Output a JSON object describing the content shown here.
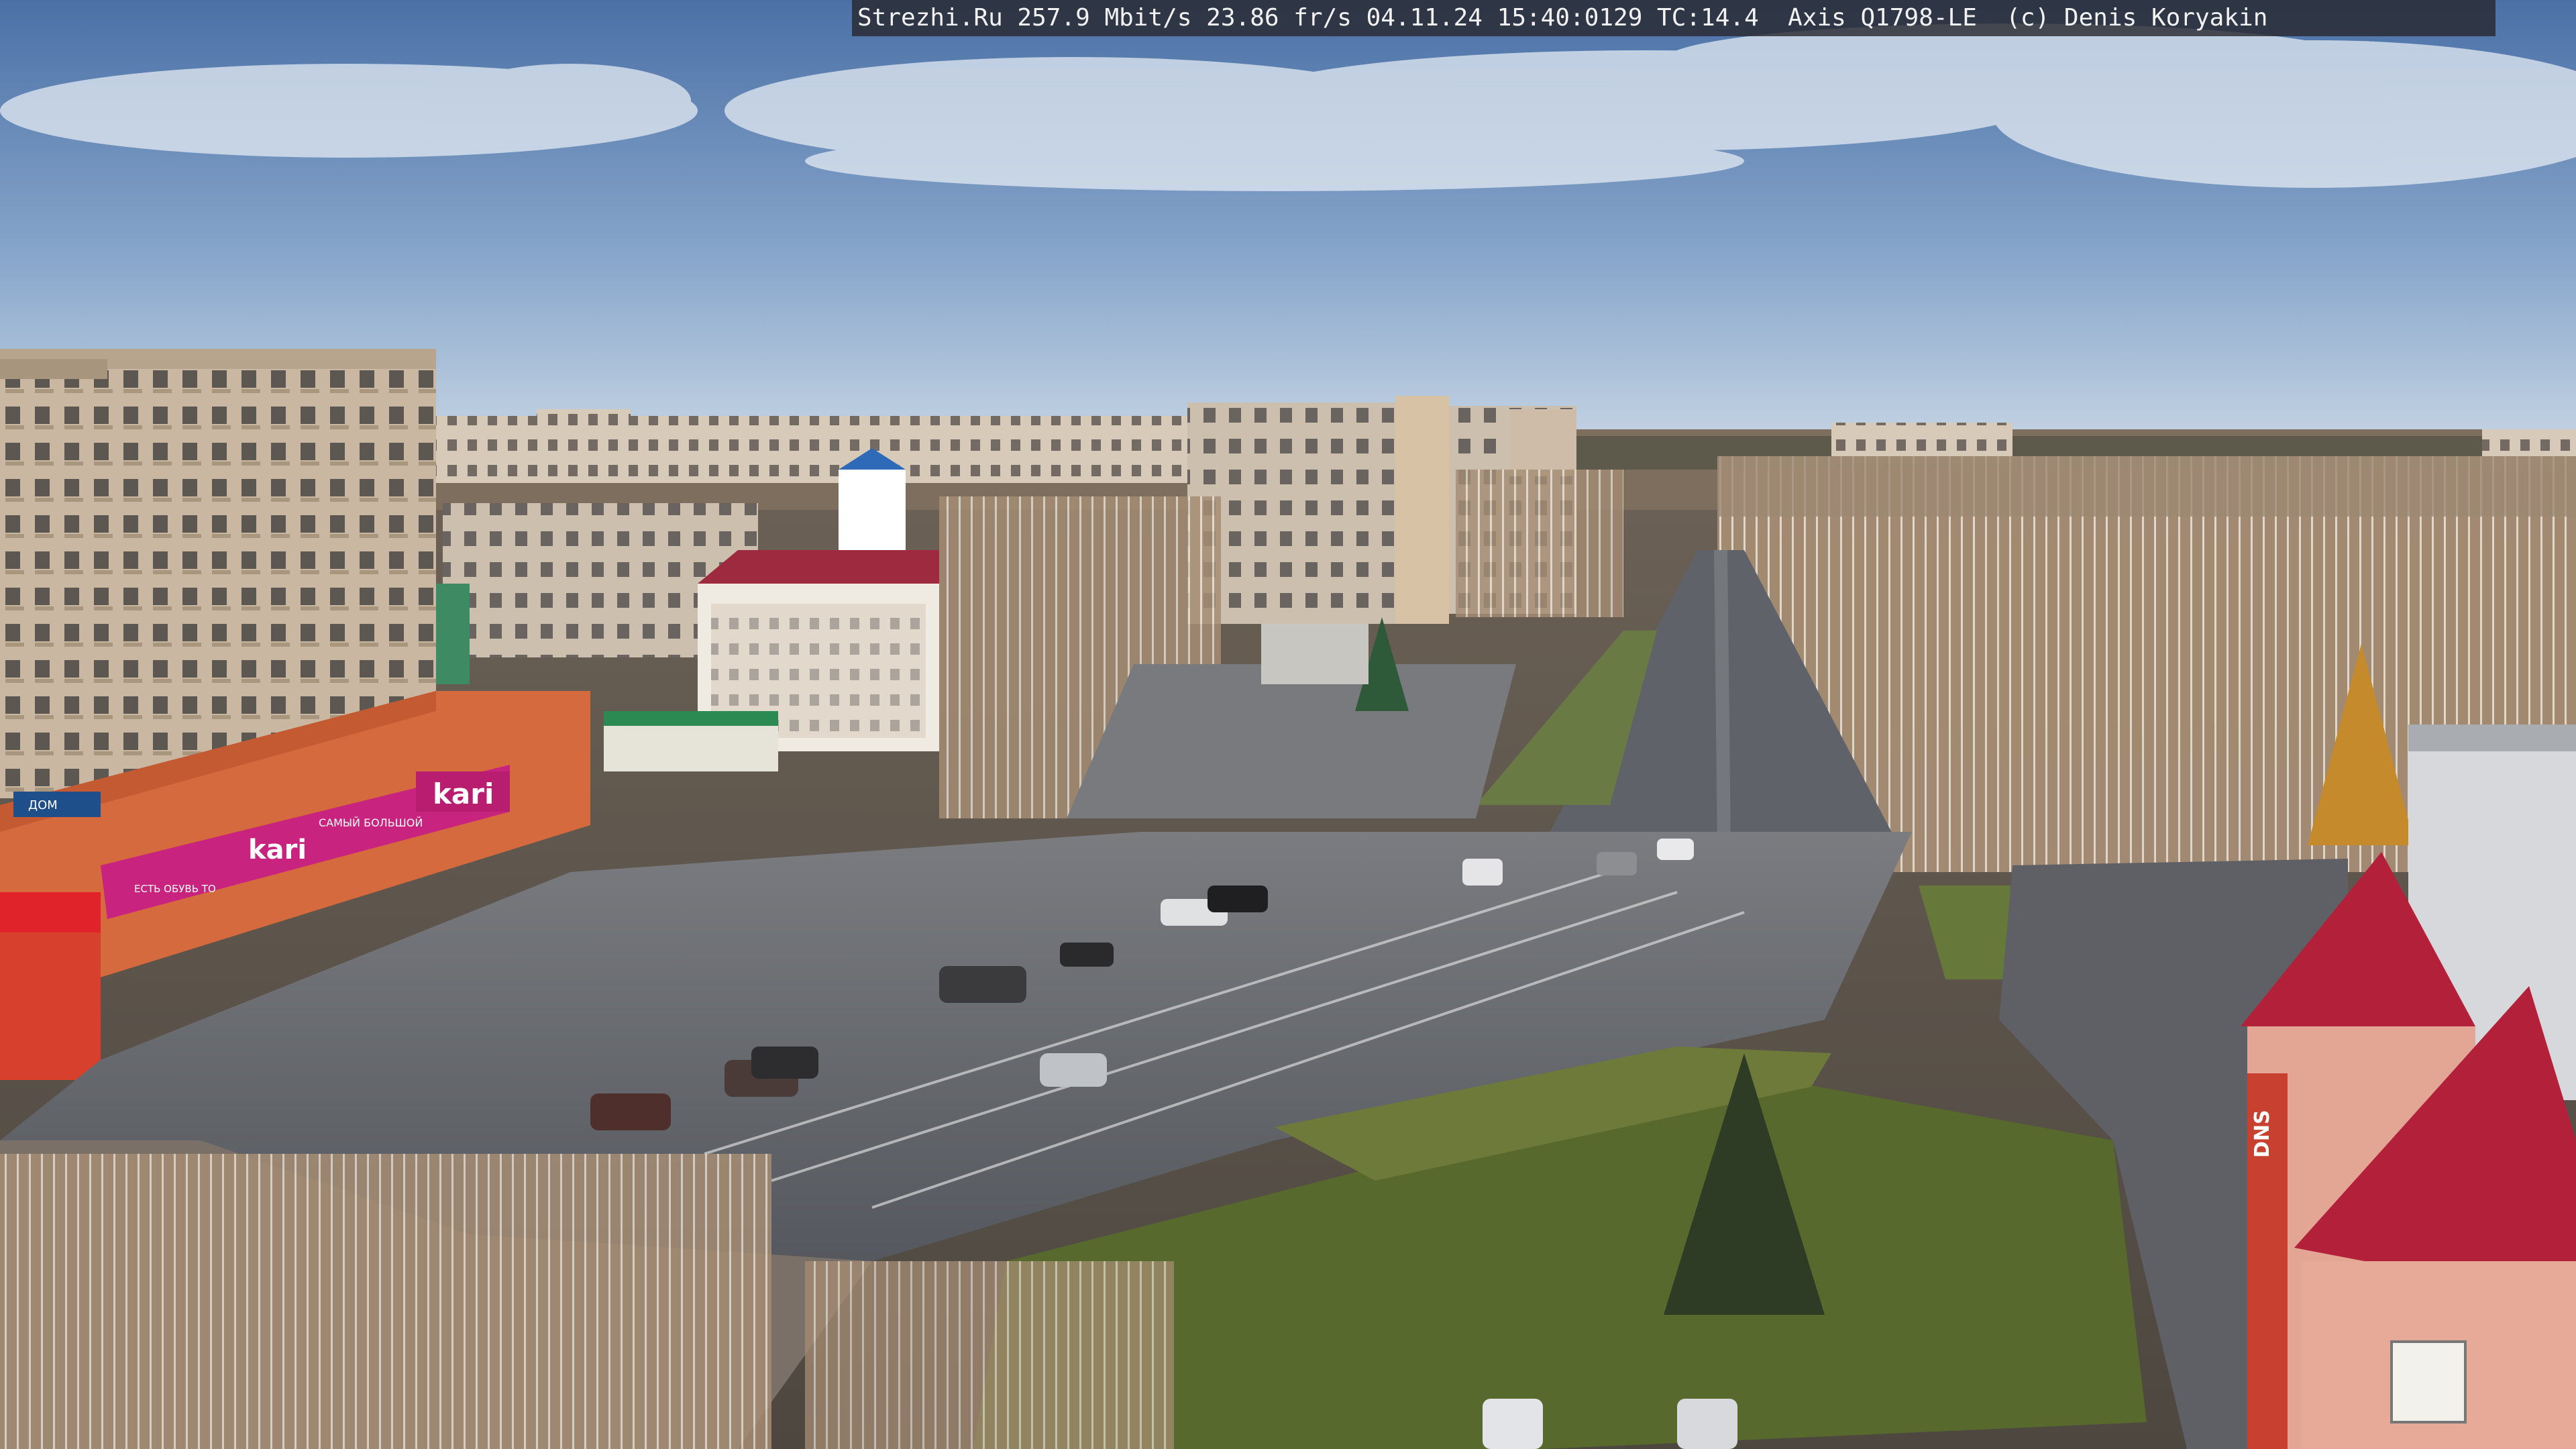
{
  "overlay": {
    "caption": "Strezhi.Ru 257.9 Mbit/s 23.86 fr/s 04.11.24 15:40:0129 TC:14.4  Axis Q1798-LE  (c) Denis Koryakin"
  },
  "signs": {
    "kari_main": "kari",
    "kari_banner": "kari",
    "banner_small": "САМЫЙ БОЛЬШОЙ",
    "banner_left": "ЕСТЬ ОБУВЬ ТО",
    "top_left_sign": "ДОМ",
    "dns": "DNS"
  },
  "colors": {
    "sky_top": "#4f74a8",
    "sky_bottom": "#b9cbe0",
    "road": "#5d6068",
    "grass": "#6b7a3a",
    "kari_magenta": "#c8237e",
    "roof_red": "#b3203a"
  }
}
